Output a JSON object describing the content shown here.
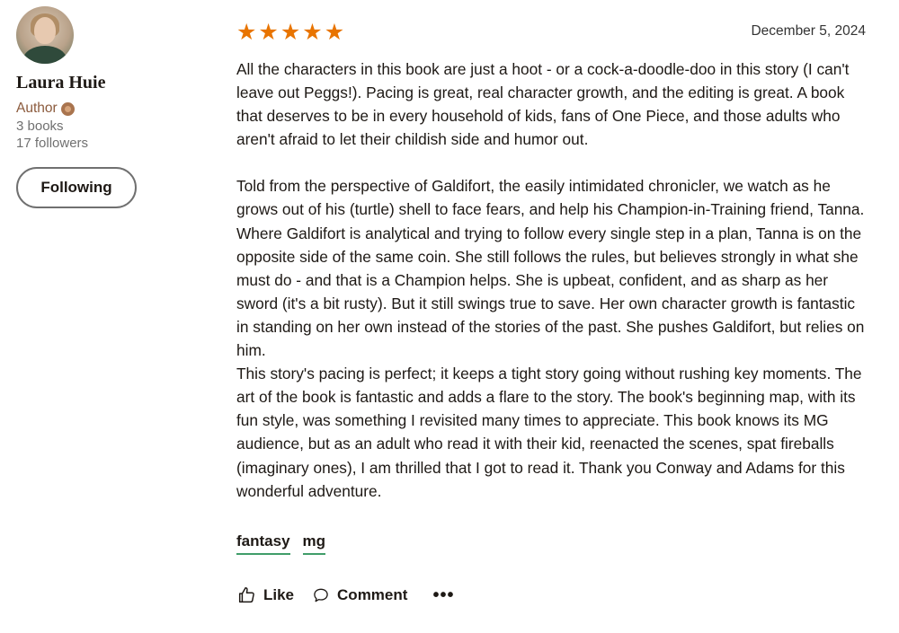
{
  "author": {
    "name": "Laura Huie",
    "role": "Author",
    "books": "3 books",
    "followers": "17 followers",
    "follow_button": "Following"
  },
  "review": {
    "rating": 5,
    "stars": [
      "★",
      "★",
      "★",
      "★",
      "★"
    ],
    "date": "December 5, 2024",
    "paragraphs": [
      "All the characters in this book are just a hoot - or a cock-a-doodle-doo in this story (I can't leave out Peggs!). Pacing is great, real character growth, and the editing is great. A book that deserves to be in every household of kids, fans of One Piece, and those adults who aren't afraid to let their childish side and humor out.",
      "Told from the perspective of Galdifort, the easily intimidated chronicler, we watch as he grows out of his (turtle) shell to face fears, and help his Champion-in-Training friend, Tanna. Where Galdifort is analytical and trying to follow every single step in a plan, Tanna is on the opposite side of the same coin. She still follows the rules, but believes strongly in what she must do - and that is a Champion helps. She is upbeat, confident, and as sharp as her sword (it's a bit rusty). But it still swings true to save. Her own character growth is fantastic in standing on her own instead of the stories of the past. She pushes Galdifort, but relies on him.",
      "This story's pacing is perfect; it keeps a tight story going without rushing key moments. The art of the book is fantastic and adds a flare to the story. The book's beginning map, with its fun style, was something I revisited many times to appreciate. This book knows its MG audience, but as an adult who read it with their kid, reenacted the scenes, spat fireballs (imaginary ones), I am thrilled that I got to read it. Thank you Conway and Adams for this wonderful adventure."
    ],
    "tags": [
      "fantasy",
      "mg"
    ]
  },
  "actions": {
    "like": "Like",
    "comment": "Comment",
    "more": "•••"
  },
  "colors": {
    "star": "#e87400",
    "tag_underline": "#409d69",
    "author_role": "#8b5a3c"
  },
  "icons": {
    "like": "thumbs-up-icon",
    "comment": "speech-bubble-icon",
    "more": "more-horizontal-icon",
    "badge": "author-badge-icon"
  }
}
